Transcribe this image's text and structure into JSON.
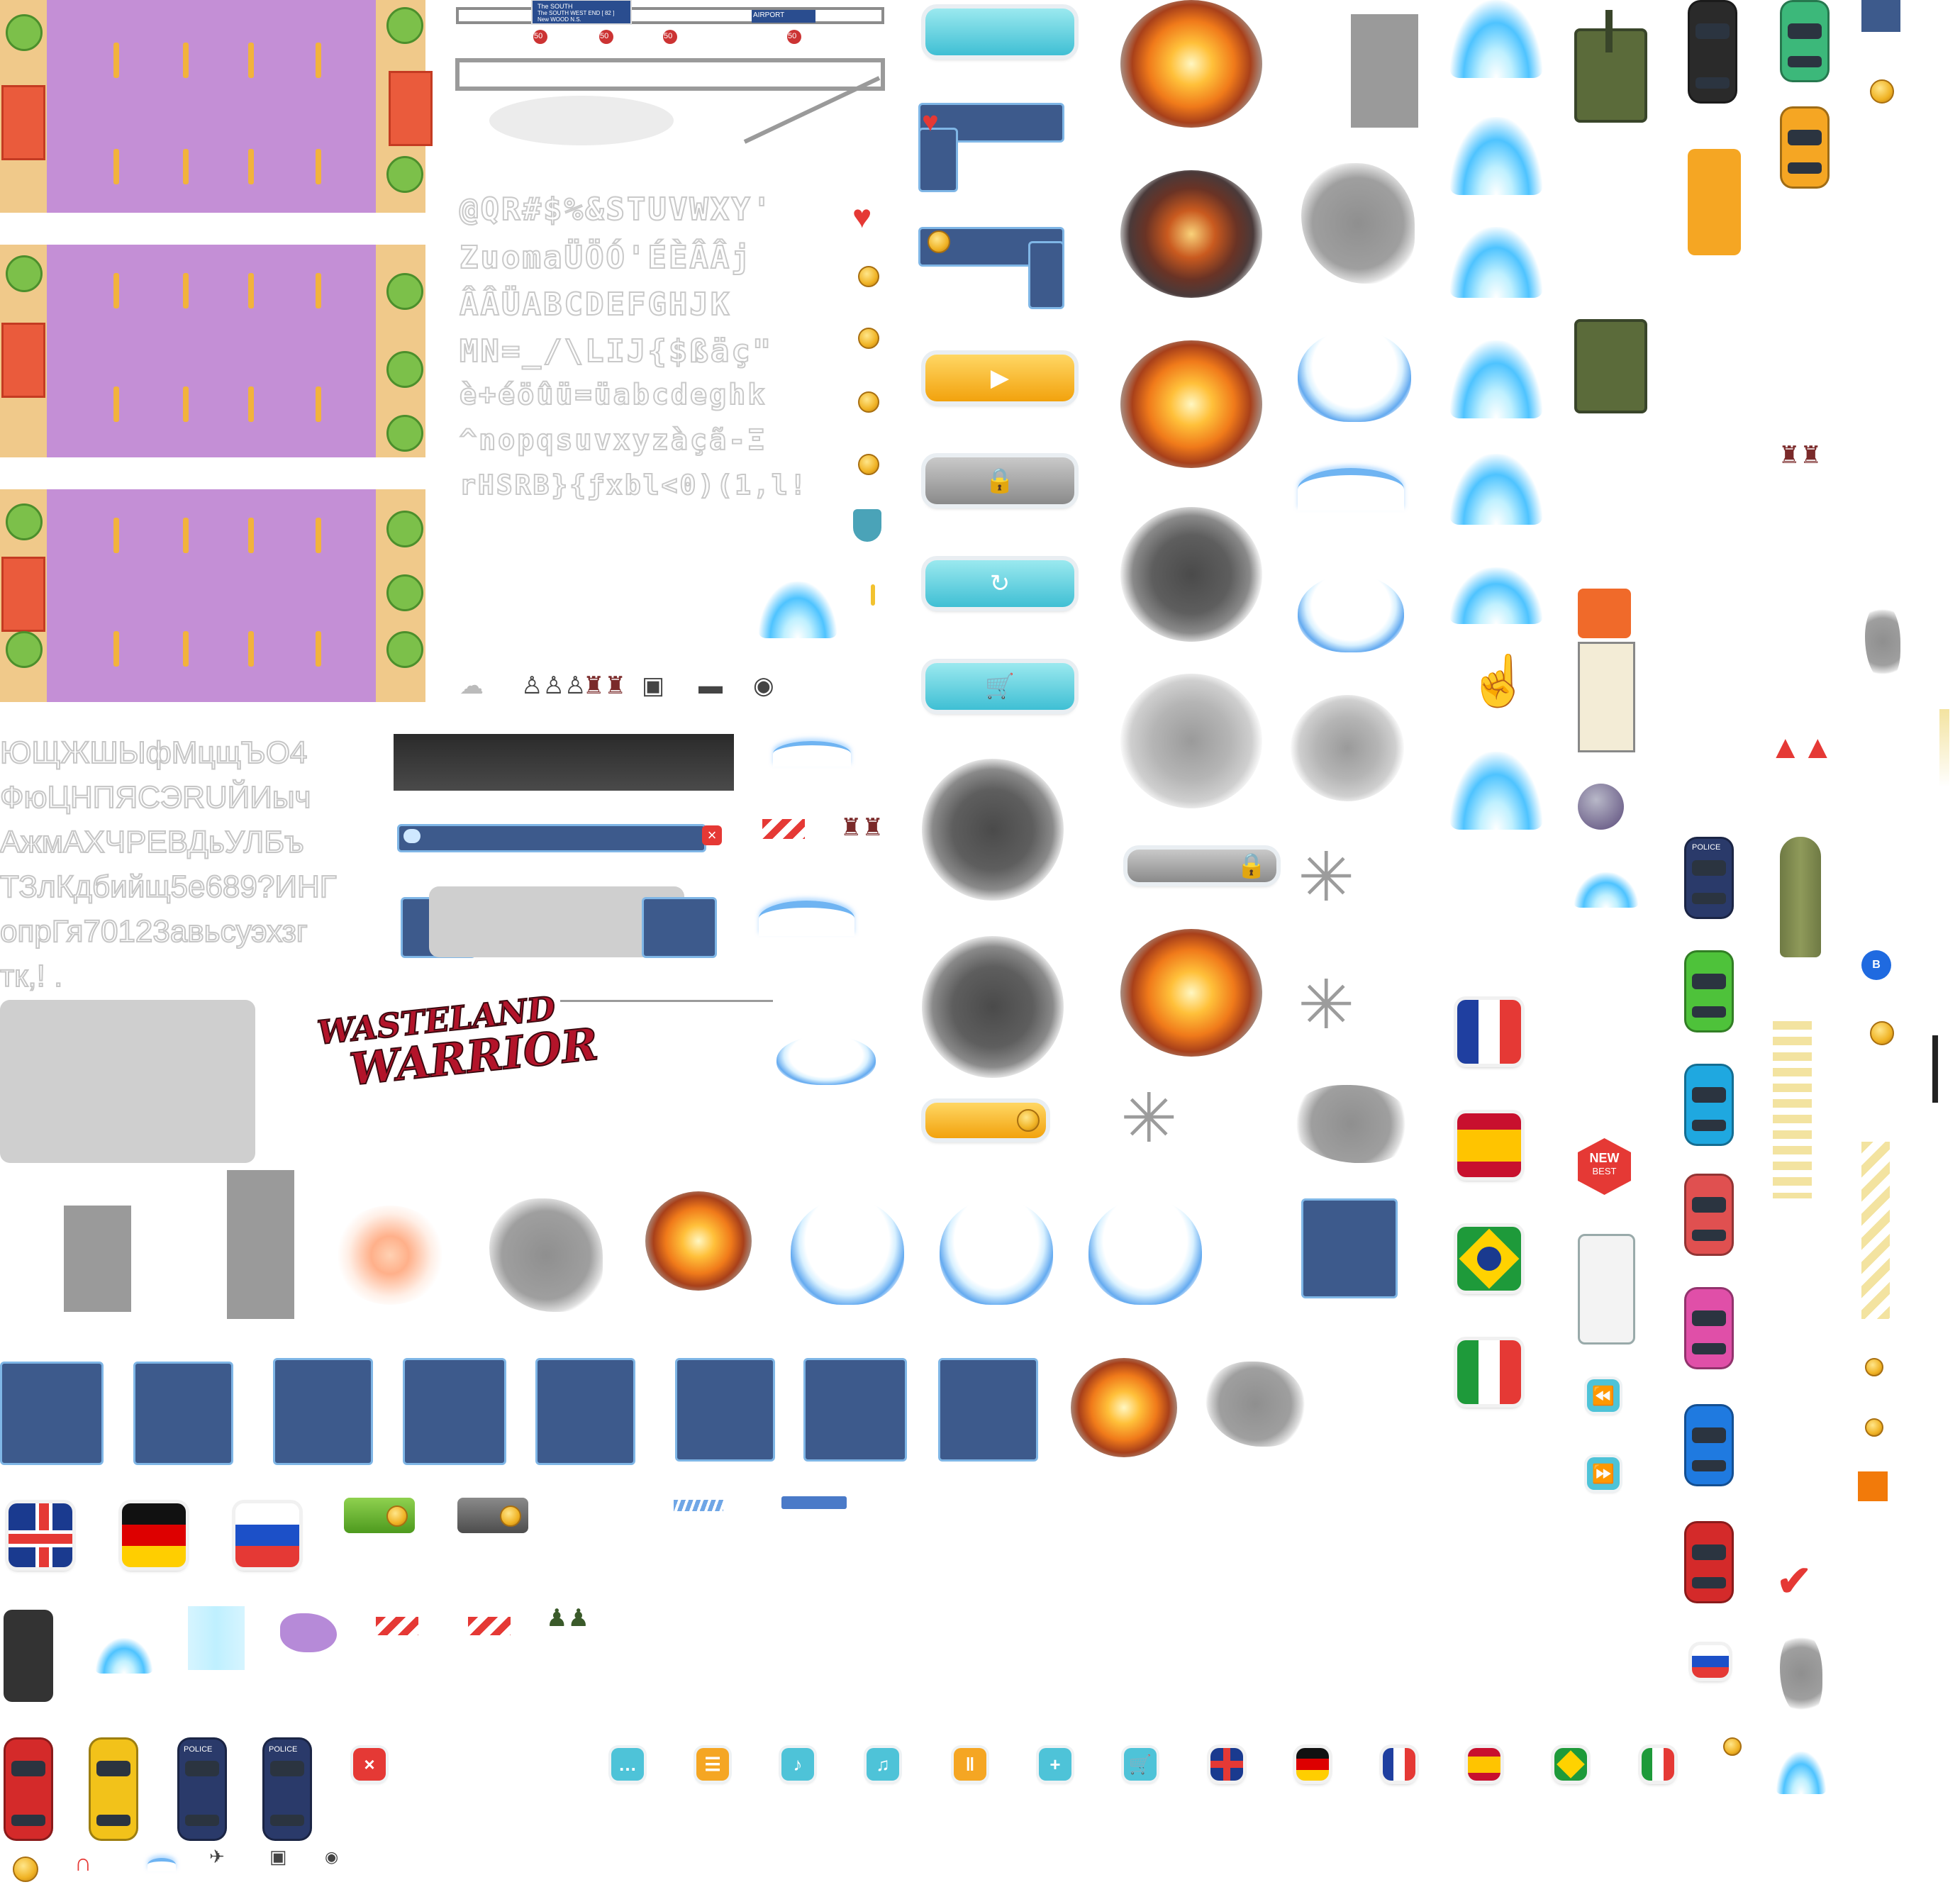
{
  "sheet": {
    "font_rows": [
      "@QR#$%&STUVWXY'",
      "ZuomaÜÖÓ'ÉÈÂÂj",
      "ÂÂÜABCDEFGHJK",
      "MN=_/\\LIJ{$ßäç\"",
      "è+éöûü=üabcdeghk",
      "^nopqsuvxyzàçã-Ξ",
      "rHSRB}{ƒxbl<0)(1,l!"
    ],
    "cyrillic_rows": [
      "ЮЩЖШЫфМцщЪО4",
      "ФюЦНПЯСЭRUЙИыч",
      "АжмАХЧРЕВДьУЛБъ",
      "ТЗлКдбийщ5е689?ИНГ",
      "опрГя70123авьсуэхзг",
      "тк,! ."
    ],
    "logo": {
      "line1": "WASTELAND",
      "line2": "WARRIOR"
    },
    "sign": {
      "l1": "The SOUTH",
      "l2": "The SOUTH WEST END [ 82 ]",
      "l3": "New WOOD N.S.",
      "airport": "AIRPORT",
      "speeds": [
        "50",
        "50",
        "50",
        "50"
      ]
    },
    "badges": {
      "new": "NEW",
      "best": "BEST",
      "police": "POLICE",
      "b": "B"
    },
    "icons": [
      "play-icon",
      "lock-icon",
      "restart-icon",
      "cart-icon",
      "heart-icon",
      "shield-icon",
      "chat-icon",
      "list-icon",
      "music-off-icon",
      "music-icon",
      "pause-icon",
      "plus-icon",
      "cart-icon",
      "rewind-icon",
      "fast-forward-icon",
      "check-icon",
      "close-icon"
    ],
    "flags": [
      "United Kingdom",
      "Germany",
      "Russia",
      "France",
      "Spain",
      "Brazil",
      "Italy"
    ],
    "colors": {
      "road": "#c48fd6",
      "panel": "#3d5a8c",
      "cyan": "#3fbfd4",
      "gold": "#f2a20d",
      "red": "#e53935"
    }
  }
}
